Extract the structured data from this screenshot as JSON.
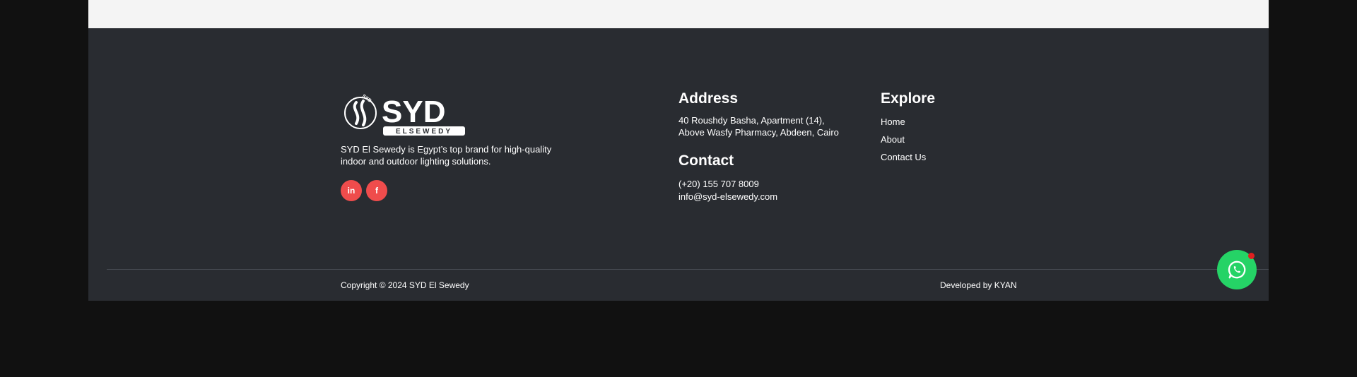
{
  "footer": {
    "brand": {
      "logo_text": "SYD",
      "logo_subtext": "ELSEWEDY",
      "logo_ring_text": "SYD EL SEWEDY",
      "tagline": "SYD El Sewedy is Egypt’s top brand for high-quality indoor and outdoor lighting solutions."
    },
    "social": {
      "linkedin_label": "in",
      "facebook_label": "f"
    },
    "address": {
      "heading": "Address",
      "line1": "40 Roushdy Basha, Apartment (14),",
      "line2": "Above Wasfy Pharmacy, Abdeen, Cairo"
    },
    "contact": {
      "heading": "Contact",
      "phone": "(+20) 155 707 8009",
      "email": "info@syd-elsewedy.com"
    },
    "explore": {
      "heading": "Explore",
      "links": [
        "Home",
        "About",
        "Contact Us"
      ]
    },
    "bottom": {
      "copyright": "Copyright © 2024 SYD El Sewedy",
      "developed_by": "Developed by KYAN"
    }
  },
  "colors": {
    "footer_bg": "#292c31",
    "social_accent": "#ef4c4c",
    "whatsapp_green": "#25d366"
  },
  "icons": {
    "whatsapp": "whatsapp-icon",
    "linkedin": "linkedin-icon",
    "facebook": "facebook-icon"
  }
}
